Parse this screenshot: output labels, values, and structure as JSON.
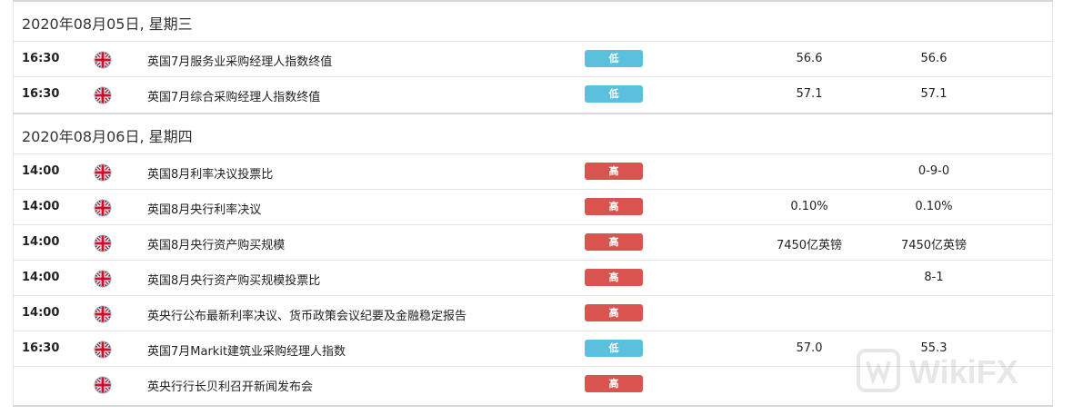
{
  "days": [
    {
      "date": "2020年08月05日, 星期三",
      "events": [
        {
          "time": "16:30",
          "flag_icon": "uk-flag-icon",
          "name": "英国7月服务业采购经理人指数终值",
          "importance": "低",
          "level": "low",
          "previous": "56.6",
          "forecast": "56.6"
        },
        {
          "time": "16:30",
          "flag_icon": "uk-flag-icon",
          "name": "英国7月综合采购经理人指数终值",
          "importance": "低",
          "level": "low",
          "previous": "57.1",
          "forecast": "57.1"
        }
      ]
    },
    {
      "date": "2020年08月06日, 星期四",
      "events": [
        {
          "time": "14:00",
          "flag_icon": "uk-flag-icon",
          "name": "英国8月利率决议投票比",
          "importance": "高",
          "level": "high",
          "previous": "",
          "forecast": "0-9-0"
        },
        {
          "time": "14:00",
          "flag_icon": "uk-flag-icon",
          "name": "英国8月央行利率决议",
          "importance": "高",
          "level": "high",
          "previous": "0.10%",
          "forecast": "0.10%"
        },
        {
          "time": "14:00",
          "flag_icon": "uk-flag-icon",
          "name": "英国8月央行资产购买规模",
          "importance": "高",
          "level": "high",
          "previous": "7450亿英镑",
          "forecast": "7450亿英镑"
        },
        {
          "time": "14:00",
          "flag_icon": "uk-flag-icon",
          "name": "英国8月央行资产购买规模投票比",
          "importance": "高",
          "level": "high",
          "previous": "",
          "forecast": "8-1"
        },
        {
          "time": "14:00",
          "flag_icon": "uk-flag-icon",
          "name": "英央行公布最新利率决议、货币政策会议纪要及金融稳定报告",
          "importance": "高",
          "level": "high",
          "previous": "",
          "forecast": ""
        },
        {
          "time": "16:30",
          "flag_icon": "uk-flag-icon",
          "name": "英国7月Markit建筑业采购经理人指数",
          "importance": "低",
          "level": "low",
          "previous": "57.0",
          "forecast": "55.3"
        },
        {
          "time": "",
          "flag_icon": "uk-flag-icon",
          "name": "英央行行长贝利召开新闻发布会",
          "importance": "高",
          "level": "high",
          "previous": "",
          "forecast": ""
        }
      ]
    }
  ],
  "colors": {
    "low": "#5bc0de",
    "high": "#d9534f"
  },
  "watermark": {
    "icon": "wikifx-logo-icon",
    "text": "WikiFX"
  }
}
